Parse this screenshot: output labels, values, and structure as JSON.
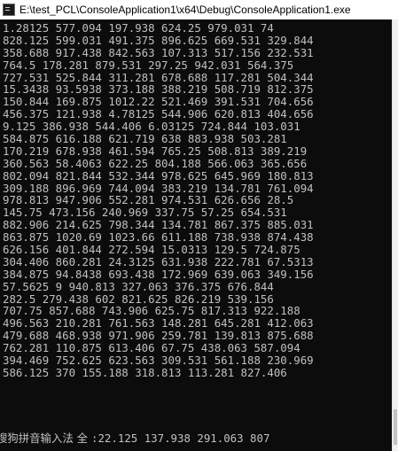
{
  "window": {
    "title": "E:\\test_PCL\\ConsoleApplication1\\x64\\Debug\\ConsoleApplication1.exe"
  },
  "icons": {
    "app": "console-app-icon"
  },
  "console": {
    "lines": [
      "1.28125 577.094 197.938 624.25 979.031 74",
      "828.125 599.031 491.375 896.625 669.531 329.844",
      "358.688 917.438 842.563 107.313 517.156 232.531",
      "764.5 178.281 879.531 297.25 942.031 564.375",
      "727.531 525.844 311.281 678.688 117.281 504.344",
      "15.3438 93.5938 373.188 388.219 508.719 812.375",
      "150.844 169.875 1012.22 521.469 391.531 704.656",
      "456.375 121.938 4.78125 544.906 620.813 404.656",
      "9.125 386.938 544.406 6.03125 724.844 103.031",
      "584.875 616.188 621.719 638 883.938 503.281",
      "170.219 678.938 461.594 765.25 508.813 389.219",
      "360.563 58.4063 622.25 804.188 566.063 365.656",
      "802.094 821.844 532.344 978.625 645.969 180.813",
      "309.188 896.969 744.094 383.219 134.781 761.094",
      "978.813 947.906 552.281 974.531 626.656 28.5",
      "145.75 473.156 240.969 337.75 57.25 654.531",
      "882.906 214.625 798.344 134.781 867.375 885.031",
      "863.875 1020.69 1023.66 611.188 738.938 874.438",
      "626.156 401.844 272.594 15.0313 129.5 724.875",
      "304.406 860.281 24.3125 631.938 222.781 67.5313",
      "384.875 94.8438 693.438 172.969 639.063 349.156",
      "57.5625 9 940.813 327.063 376.375 676.844",
      "282.5 279.438 602 821.625 826.219 539.156",
      "707.75 857.688 743.906 625.75 817.313 922.188",
      "496.563 210.281 761.563 148.281 645.281 412.063",
      "479.688 468.938 971.906 259.781 139.813 875.688",
      "762.281 110.875 613.406 67.75 438.063 587.094",
      "394.469 752.625 623.563 309.531 561.188 230.969",
      "586.125 370 155.188 318.813 113.281 827.406"
    ],
    "ime_text": "搜狗拼音输入法 全 ",
    "partial_line": ":22.125 137.938 291.063 807"
  }
}
